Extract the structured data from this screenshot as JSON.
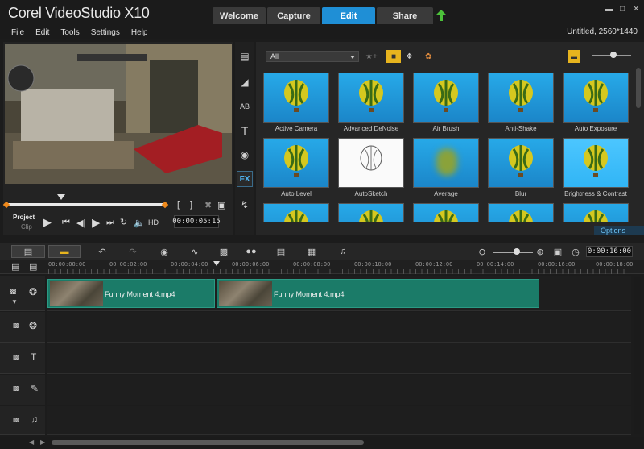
{
  "app": {
    "brand": "Corel VideoStudio X10",
    "project_info": "Untitled, 2560*1440"
  },
  "tabs": [
    {
      "label": "Welcome",
      "active": false
    },
    {
      "label": "Capture",
      "active": false
    },
    {
      "label": "Edit",
      "active": true
    },
    {
      "label": "Share",
      "active": false
    }
  ],
  "menu": [
    "File",
    "Edit",
    "Tools",
    "Settings",
    "Help"
  ],
  "player": {
    "project_label": "Project",
    "clip_label": "Clip",
    "hd_label": "HD",
    "timecode": "00:00:05:15",
    "scrub_position": 0.35
  },
  "library": {
    "filter": "All",
    "options_label": "Options",
    "filters": [
      "Active Camera",
      "Advanced DeNoise",
      "Air Brush",
      "Anti-Shake",
      "Auto Exposure",
      "Auto Level",
      "AutoSketch",
      "Average",
      "Blur",
      "Brightness & Contrast",
      "",
      "",
      "",
      "",
      ""
    ]
  },
  "timeline": {
    "timecode": "0:00:16:00",
    "ruler": [
      "00:00:00:00",
      "00:00:02:00",
      "00:00:04:00",
      "00:00:06:00",
      "00:00:08:00",
      "00:00:10:00",
      "00:00:12:00",
      "00:00:14:00",
      "00:00:16:00",
      "00:00:18:00"
    ],
    "clips": [
      {
        "name": "Funny Moment 4.mp4"
      },
      {
        "name": "Funny Moment 4.mp4"
      }
    ]
  },
  "colors": {
    "accent": "#1f8fd6",
    "clip": "#1b7b68",
    "options": "#6cc3f5"
  },
  "icons": [
    "upload-icon",
    "minimize-icon",
    "maximize-icon",
    "close-icon",
    "play-icon",
    "home-icon",
    "prev-frame-icon",
    "next-frame-icon",
    "end-icon",
    "repeat-icon",
    "volume-icon",
    "media-icon",
    "transition-icon",
    "title-icon",
    "text-icon",
    "graphic-icon",
    "fx-icon",
    "path-icon",
    "undo-icon",
    "redo-icon",
    "record-icon",
    "audio-icon",
    "motion-icon",
    "mask-icon",
    "subtitle-icon",
    "multi-camera-icon",
    "zoom-out-icon",
    "zoom-in-icon",
    "fit-icon",
    "clock-icon"
  ]
}
